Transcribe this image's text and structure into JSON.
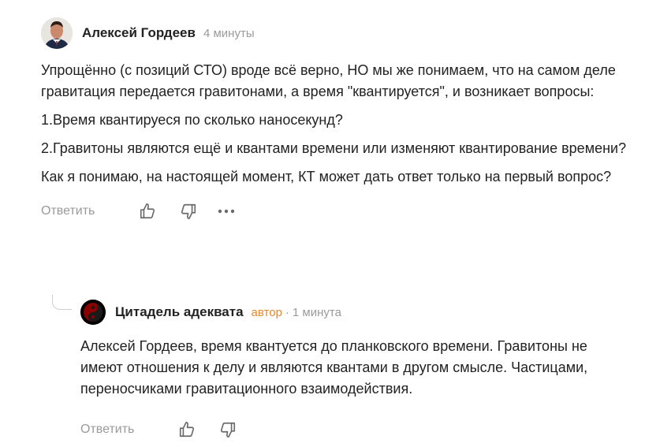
{
  "comment1": {
    "author": "Алексей Гордеев",
    "time": "4 минуты",
    "paragraphs": [
      "Упрощённо (с позиций СТО) вроде всё верно, НО мы же понимаем, что на самом деле гравитация передается гравитонами, а время \"квантируется\", и возникает вопросы:",
      "1.Время квантируеся по сколько наносекунд?",
      "2.Гравитоны являются ещё и квантами времени или изменяют квантирование времени?",
      "Как я понимаю, на настоящей момент, КТ может дать ответ только на первый вопрос?"
    ],
    "reply_label": "Ответить",
    "icons": [
      "thumbs-up-icon",
      "thumbs-down-icon",
      "more-icon"
    ]
  },
  "comment2": {
    "author": "Цитадель адеквата",
    "badge": "автор",
    "separator": "·",
    "time": "1 минута",
    "paragraphs": [
      "Алексей Гордеев, время квантуется до планковского времени. Гравитоны не имеют отношения к делу и являются квантами в другом смысле. Частицами, переносчиками гравитационного взаимодействия."
    ],
    "reply_label": "Ответить",
    "icons": [
      "thumbs-up-icon",
      "thumbs-down-icon"
    ]
  },
  "colors": {
    "meta": "#9a9a9a",
    "badge": "#e58a2c",
    "text": "#222222"
  }
}
